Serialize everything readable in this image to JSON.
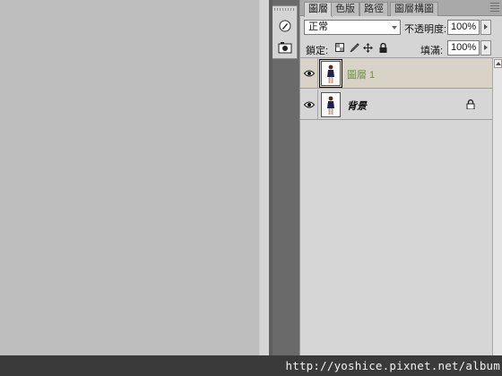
{
  "tabs": [
    {
      "label": "圖層",
      "active": true
    },
    {
      "label": "色版",
      "active": false
    },
    {
      "label": "路徑",
      "active": false
    },
    {
      "label": "圖層構圖",
      "active": false
    }
  ],
  "options": {
    "blend_mode": "正常",
    "opacity_label": "不透明度:",
    "opacity_value": "100%",
    "lock_label": "鎖定:",
    "fill_label": "填滿:",
    "fill_value": "100%"
  },
  "layers": [
    {
      "name": "圖層 1",
      "selected": true,
      "visible": true
    },
    {
      "name": "背景",
      "selected": false,
      "visible": true,
      "locked": true
    }
  ],
  "colors": {
    "selected_layer_bg": "#d9d2c6",
    "selected_layer_name": "#6c8f4a",
    "panel_bg": "#d5d5d5",
    "canvas_bg": "#bebebe"
  },
  "watermark": "http://yoshice.pixnet.net/album"
}
